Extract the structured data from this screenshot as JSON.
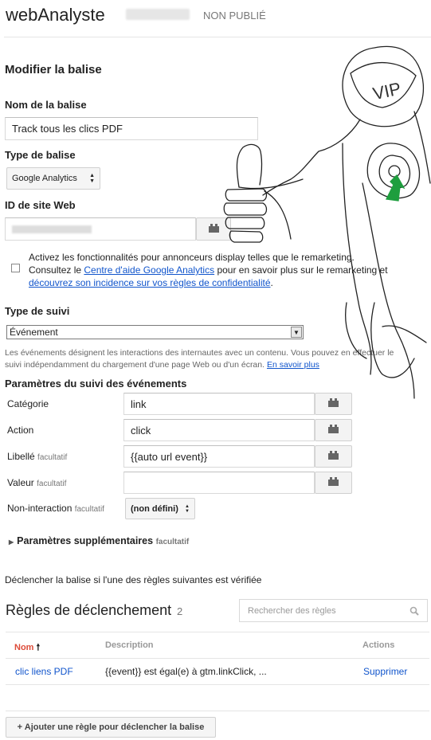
{
  "header": {
    "app_title": "webAnalyste",
    "status": "NON PUBLIÉ"
  },
  "page_title": "Modifier la balise",
  "fields": {
    "tag_name_label": "Nom de la balise",
    "tag_name_value": "Track tous les clics PDF",
    "tag_type_label": "Type de balise",
    "tag_type_value": "Google Analytics",
    "site_id_label": "ID de site Web"
  },
  "display_features": {
    "line1": "Activez les fonctionnalités pour annonceurs display telles que le remarketing.",
    "line2_pre": "Consultez le ",
    "line2_link": "Centre d'aide Google Analytics",
    "line2_post": " pour en savoir plus sur le remarketing et",
    "line3_link": "découvrez son incidence sur vos règles de confidentialité",
    "line3_post": "."
  },
  "tracking": {
    "label": "Type de suivi",
    "value": "Événement",
    "help_line1": "Les événements désignent les interactions des internautes avec un contenu. Vous pouvez en effectuer le",
    "help_line2": "suivi indépendamment du chargement d'une page Web ou d'un écran.",
    "help_link": "En savoir plus"
  },
  "event_params": {
    "title": "Paramètres du suivi des événements",
    "optional": "facultatif",
    "category_label": "Catégorie",
    "category_value": "link",
    "action_label": "Action",
    "action_value": "click",
    "label_label": "Libellé",
    "label_value": "{{auto url event}}",
    "value_label": "Valeur",
    "value_value": "",
    "noninteraction_label": "Non-interaction",
    "noninteraction_value": "(non défini)"
  },
  "more_params": {
    "label": "Paramètres supplémentaires",
    "optional": "facultatif"
  },
  "fire_rule_text": "Déclencher la balise si l'une des règles suivantes est vérifiée",
  "rules": {
    "title": "Règles de déclenchement",
    "count": "2",
    "search_placeholder": "Rechercher des règles",
    "columns": {
      "name": "Nom",
      "description": "Description",
      "actions": "Actions"
    },
    "rows": [
      {
        "name": "clic liens PDF",
        "description": "{{event}} est égal(e) à gtm.linkClick, ...",
        "action": "Supprimer"
      }
    ],
    "add_button": "+ Ajouter une règle pour déclencher la balise"
  },
  "doodle": {
    "helmet_text": "VIP"
  },
  "colors": {
    "link": "#1155cc",
    "sort_active": "#dd4b39",
    "doodle_green": "#1e9e3e"
  },
  "icons": [
    "variable-brick-icon",
    "sort-arrow-icon",
    "search-icon",
    "triangle-right-icon",
    "select-arrows-icon"
  ]
}
